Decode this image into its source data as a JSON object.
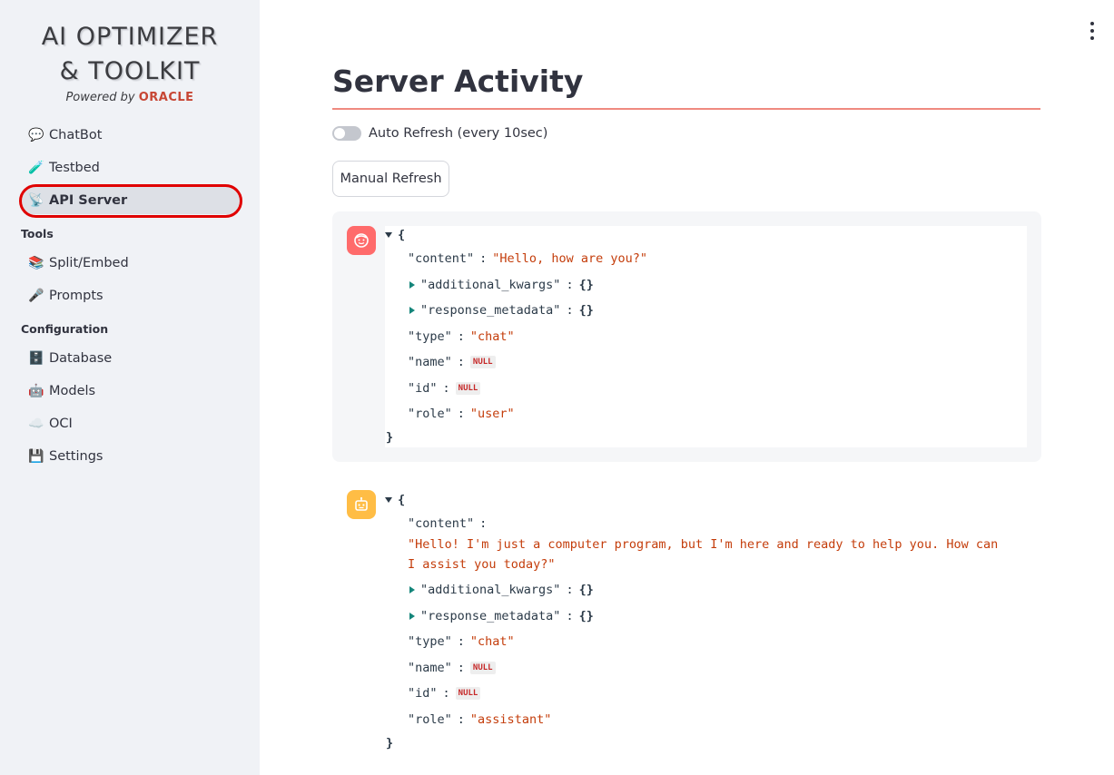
{
  "logo": {
    "line1": "AI OPTIMIZER",
    "line2": "& TOOLKIT",
    "powered_by": "Powered by",
    "oracle": "ORACLE"
  },
  "sidebar": {
    "items": [
      {
        "label": "ChatBot",
        "icon": "speech-bubble-icon",
        "glyph": "💬"
      },
      {
        "label": "Testbed",
        "icon": "test-tube-icon",
        "glyph": "🧪"
      },
      {
        "label": "API Server",
        "icon": "satellite-antenna-icon",
        "glyph": "📡",
        "active": true
      }
    ],
    "sections": [
      {
        "label": "Tools",
        "items": [
          {
            "label": "Split/Embed",
            "icon": "books-icon",
            "glyph": "📚"
          },
          {
            "label": "Prompts",
            "icon": "microphone-icon",
            "glyph": "🎤"
          }
        ]
      },
      {
        "label": "Configuration",
        "items": [
          {
            "label": "Database",
            "icon": "file-cabinet-icon",
            "glyph": "🗄️"
          },
          {
            "label": "Models",
            "icon": "robot-icon",
            "glyph": "🤖"
          },
          {
            "label": "OCI",
            "icon": "cloud-icon",
            "glyph": "☁️"
          },
          {
            "label": "Settings",
            "icon": "floppy-disk-icon",
            "glyph": "💾"
          }
        ]
      }
    ]
  },
  "main": {
    "title": "Server Activity",
    "auto_refresh_label": "Auto Refresh (every 10sec)",
    "auto_refresh_on": false,
    "manual_refresh_label": "Manual Refresh",
    "accent_color": "#ef8a80"
  },
  "messages": [
    {
      "role_icon": "user-face-icon",
      "avatar_color": "#ff6b6b",
      "open_brace": "{",
      "close_brace": "}",
      "content_key": "\"content\"",
      "content": "\"Hello, how are you?\"",
      "additional_kwargs_key": "\"additional_kwargs\"",
      "additional_kwargs": "{}",
      "response_metadata_key": "\"response_metadata\"",
      "response_metadata": "{}",
      "type_key": "\"type\"",
      "type": "\"chat\"",
      "name_key": "\"name\"",
      "name": "NULL",
      "id_key": "\"id\"",
      "id": "NULL",
      "role_key": "\"role\"",
      "role": "\"user\""
    },
    {
      "role_icon": "robot-icon",
      "avatar_color": "#ffbd45",
      "open_brace": "{",
      "close_brace": "}",
      "content_key": "\"content\"",
      "content_line1": "\"Hello! I'm just a computer program, but I'm here and ready to help you. How can",
      "content_line2": "I assist you today?\"",
      "additional_kwargs_key": "\"additional_kwargs\"",
      "additional_kwargs": "{}",
      "response_metadata_key": "\"response_metadata\"",
      "response_metadata": "{}",
      "type_key": "\"type\"",
      "type": "\"chat\"",
      "name_key": "\"name\"",
      "name": "NULL",
      "id_key": "\"id\"",
      "id": "NULL",
      "role_key": "\"role\"",
      "role": "\"assistant\""
    }
  ]
}
